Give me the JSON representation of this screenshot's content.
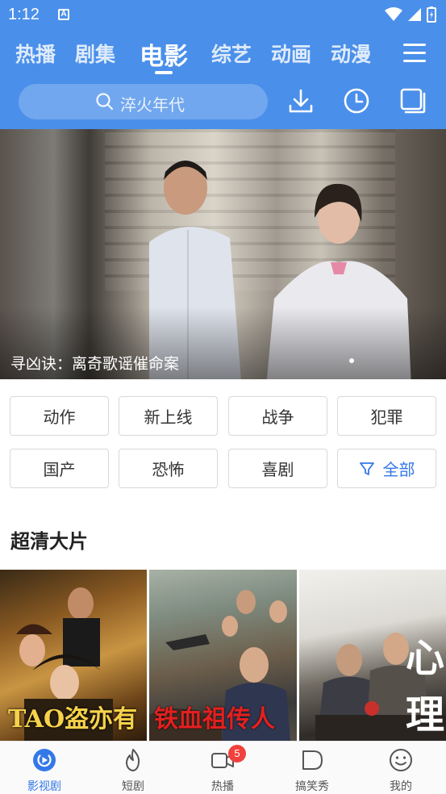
{
  "status_bar": {
    "time": "1:12",
    "notification_icon": "A"
  },
  "tabs": [
    {
      "label": "热播"
    },
    {
      "label": "剧集"
    },
    {
      "label": "电影"
    },
    {
      "label": "综艺"
    },
    {
      "label": "动画"
    },
    {
      "label": "动漫"
    }
  ],
  "active_tab": "电影",
  "search": {
    "placeholder": "淬火年代"
  },
  "header_icons": [
    "download-icon",
    "history-clock-icon",
    "screen-cast-icon"
  ],
  "banner": {
    "caption": "寻凶诀：离奇歌谣催命案",
    "current_slide": 1
  },
  "genres": [
    {
      "label": "动作"
    },
    {
      "label": "新上线"
    },
    {
      "label": "战争"
    },
    {
      "label": "犯罪"
    },
    {
      "label": "国产"
    },
    {
      "label": "恐怖"
    },
    {
      "label": "喜剧"
    },
    {
      "label": "全部"
    }
  ],
  "section": {
    "title": "超清大片"
  },
  "posters": [
    {
      "title_art": "TAO盗亦有道"
    },
    {
      "title_art": "铁血祖传人"
    },
    {
      "title_art": "心理罪"
    }
  ],
  "bottom_nav": [
    {
      "label": "影视剧",
      "icon": "play-circle-icon",
      "active": true
    },
    {
      "label": "短剧",
      "icon": "flame-icon"
    },
    {
      "label": "热播",
      "icon": "video-camera-icon",
      "badge": "5"
    },
    {
      "label": "搞笑秀",
      "icon": "speech-bubble-icon"
    },
    {
      "label": "我的",
      "icon": "smiley-face-icon"
    }
  ],
  "colors": {
    "header_blue": "#4a8fea",
    "accent_blue": "#3478e8",
    "badge_red": "#f1413d"
  }
}
